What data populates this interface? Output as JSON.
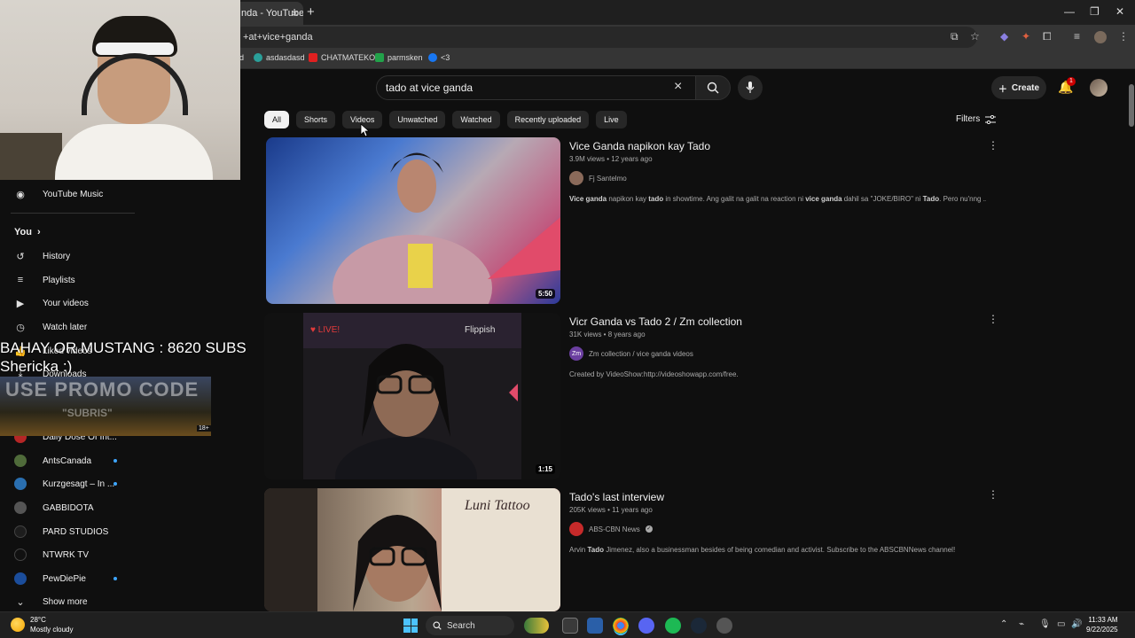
{
  "browser": {
    "tab_title": "nda - YouTube",
    "tab_close": "×",
    "new_tab": "+",
    "url": "+at+vice+ganda",
    "bookmarks": [
      "d",
      "asdasdasd",
      "CHATMATEKO",
      "parmsken",
      "<3"
    ]
  },
  "search": {
    "query": "tado at vice ganda",
    "clear": "×"
  },
  "header": {
    "create_label": "Create",
    "notification_count": "1"
  },
  "chips": [
    "All",
    "Shorts",
    "Videos",
    "Unwatched",
    "Watched",
    "Recently uploaded",
    "Live"
  ],
  "filters_label": "Filters",
  "sidebar": {
    "youtube_music": "YouTube Music",
    "you": "You",
    "items": [
      "History",
      "Playlists",
      "Your videos",
      "Watch later",
      "Liked videos",
      "Downloads"
    ],
    "subscriptions": [
      {
        "name": "Daily Dose Of Int...",
        "dot": false,
        "color": "#b52626"
      },
      {
        "name": "AntsCanada",
        "dot": true,
        "color": "#4f6b3a"
      },
      {
        "name": "Kurzgesagt – In ...",
        "dot": true,
        "color": "#2a6fb0"
      },
      {
        "name": "GABBIDOTA",
        "dot": false,
        "color": "#555555"
      },
      {
        "name": "PARD STUDIOS",
        "dot": false,
        "color": "#1d1d1d"
      },
      {
        "name": "NTWRK TV",
        "dot": false,
        "color": "#111111"
      },
      {
        "name": "PewDiePie",
        "dot": true,
        "color": "#1b4d9b"
      }
    ],
    "show_more": "Show more"
  },
  "stream_overlay": {
    "line1": "BAHAY OR MUSTANG : 8620 SUBS",
    "line2": "Shericka :)",
    "promo_title": "USE PROMO CODE",
    "promo_sub": "\"SUBRIS\"",
    "promo_badge": "18+"
  },
  "results": [
    {
      "title": "Vice Ganda napikon kay Tado",
      "meta": "3.9M views • 12 years ago",
      "channel": "Fj Santelmo",
      "verified": false,
      "channel_color": "#8a6a5a",
      "channel_initials": "",
      "description": [
        {
          "t": "Vice ganda",
          "b": true
        },
        {
          "t": " napikon kay ",
          "b": false
        },
        {
          "t": "tado",
          "b": true
        },
        {
          "t": " in showtime. Ang galit na galit na reaction ni ",
          "b": false
        },
        {
          "t": "vice ganda",
          "b": true
        },
        {
          "t": " dahil sa \"JOKE/BIRO\" ni ",
          "b": false
        },
        {
          "t": "Tado",
          "b": true
        },
        {
          "t": ". Pero nu'nng ...",
          "b": false
        }
      ],
      "duration": "5:50"
    },
    {
      "title": "Vicr Ganda vs Tado 2 / Zm collection",
      "meta": "31K views • 8 years ago",
      "channel": "Zm collection / vice ganda videos",
      "verified": false,
      "channel_color": "#6b3fa0",
      "channel_initials": "Zm",
      "description": [
        {
          "t": "Created by VideoShow:http://videoshowapp.com/free.",
          "b": false
        }
      ],
      "duration": "1:15"
    },
    {
      "title": "Tado's last interview",
      "meta": "205K views • 11 years ago",
      "channel": "ABS-CBN News",
      "verified": true,
      "channel_color": "#c62a2a",
      "channel_initials": "",
      "description": [
        {
          "t": "Arvin ",
          "b": false
        },
        {
          "t": "Tado",
          "b": true
        },
        {
          "t": " Jimenez, also a businessman besides of being comedian and activist. Subscribe to the ABSCBNNews channel!",
          "b": false
        }
      ],
      "duration": ""
    }
  ],
  "taskbar": {
    "temp": "28°C",
    "weather": "Mostly cloudy",
    "search_label": "Search",
    "time": "11:33 AM",
    "date": "9/22/2025"
  }
}
